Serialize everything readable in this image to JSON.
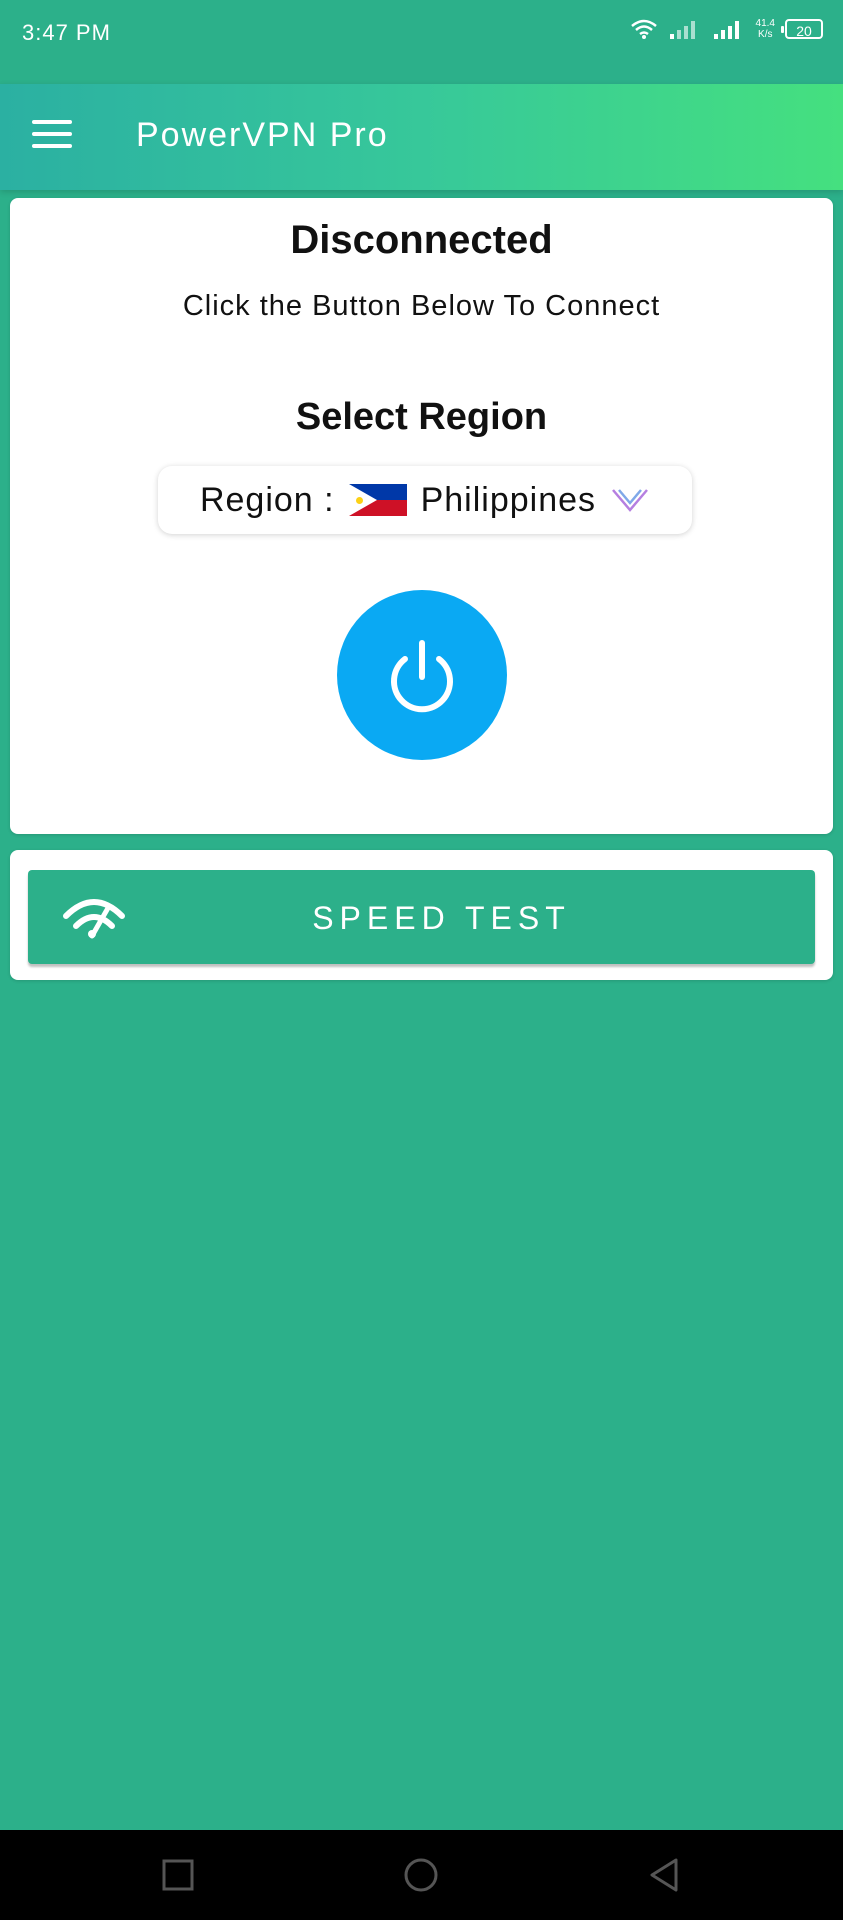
{
  "status_bar": {
    "time": "3:47 PM",
    "net_speed_value": "41.4",
    "net_speed_unit": "K/s",
    "battery": "20"
  },
  "app_bar": {
    "title": "PowerVPN Pro",
    "menu_icon": "hamburger-menu-icon"
  },
  "connection": {
    "status": "Disconnected",
    "hint": "Click the Button Below To Connect",
    "power_icon": "power-icon",
    "power_color": "#0aa9f3"
  },
  "region": {
    "heading": "Select Region",
    "label": "Region :",
    "selected": "Philippines",
    "flag_icon": "philippines-flag-icon",
    "chevron_icon": "chevron-down-icon"
  },
  "speed_test": {
    "label": "SPEED TEST",
    "icon": "speedometer-wifi-icon"
  },
  "colors": {
    "background": "#2cb08a",
    "accent": "#0aa9f3",
    "gradient_end": "#45e07f"
  }
}
